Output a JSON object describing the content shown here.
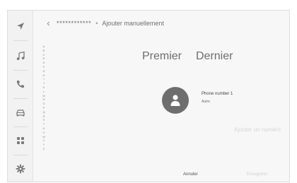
{
  "sidebar": {
    "items": [
      {
        "icon": "navigation-arrow-icon"
      },
      {
        "icon": "music-note-icon"
      },
      {
        "icon": "phone-icon"
      },
      {
        "icon": "car-icon"
      },
      {
        "icon": "apps-grid-icon"
      },
      {
        "icon": "gear-icon"
      }
    ]
  },
  "header": {
    "back_icon": "chevron-left-icon",
    "contact_name": "************",
    "separator": "•",
    "title": "Ajouter manuellement"
  },
  "alphabet_index": [
    "A",
    "B",
    "C",
    "D",
    "E",
    "F",
    "G",
    "H",
    "I",
    "J",
    "K",
    "L",
    "M",
    "N",
    "O",
    "P",
    "Q",
    "R",
    "S",
    "T",
    "U",
    "V",
    "W",
    "X",
    "Y",
    "Z"
  ],
  "name_fields": {
    "first": "Premier",
    "last": "Dernier"
  },
  "contact": {
    "avatar_icon": "person-icon",
    "phone_label": "Phone number 1",
    "phone_type": "Autre",
    "add_number": "Ajouter un numéro"
  },
  "footer": {
    "cancel": "Annuler",
    "save": "Enregistrer"
  },
  "colors": {
    "background": "#f7f7f7",
    "sidebar": "#f2f2f2",
    "icon": "#7a7a7a",
    "avatar": "#6e6e6e",
    "disabled_text": "#d2d2d2"
  }
}
